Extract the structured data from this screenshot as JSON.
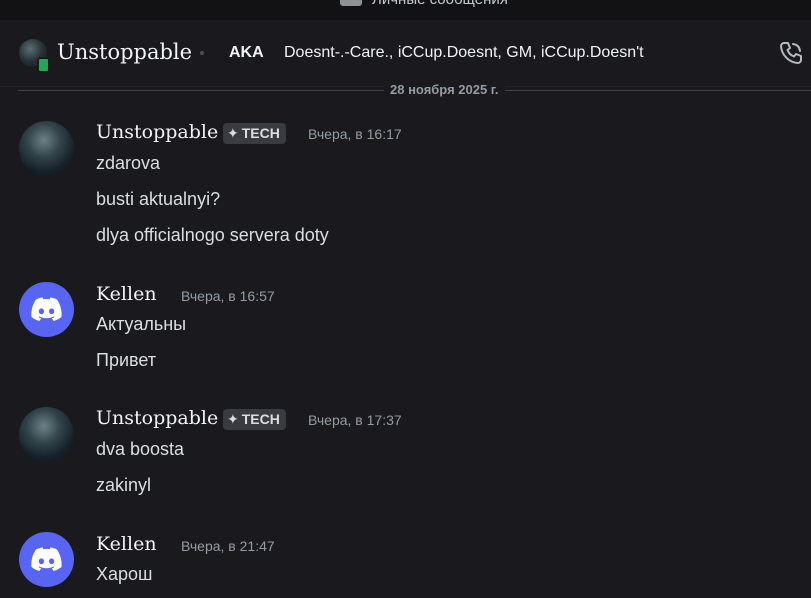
{
  "titlebar": {
    "title": "Личные сообщения",
    "icon": "direct-messages-icon"
  },
  "header": {
    "username": "Unstoppable",
    "aka_label": "AKA",
    "aka_names": "Doesnt-.-Care., iCCup.Doesnt, GM, iCCup.Doesn't",
    "status": "mobile-online",
    "status_color": "#23a55a",
    "actions": [
      "phone-call-icon"
    ]
  },
  "date_divider": "28 ноября 2025 г.",
  "messages": [
    {
      "author": "Unstoppable",
      "tag": "TECH",
      "time": "Вчера, в 16:17",
      "lines": [
        "zdarova",
        "busti aktualnyi?",
        "dlya officialnogo servera doty"
      ]
    },
    {
      "author": "Kellen",
      "time": "Вчера, в 16:57",
      "lines": [
        "Актуальны",
        "Привет"
      ]
    },
    {
      "author": "Unstoppable",
      "tag": "TECH",
      "time": "Вчера, в 17:37",
      "lines": [
        "dva boosta",
        "zakinyl"
      ]
    },
    {
      "author": "Kellen",
      "time": "Вчера, в 21:47",
      "lines": [
        "Харош"
      ]
    }
  ],
  "colors": {
    "background": "#1a1a1e",
    "discord_blurple": "#5865f2",
    "muted_text": "#949ba4"
  }
}
